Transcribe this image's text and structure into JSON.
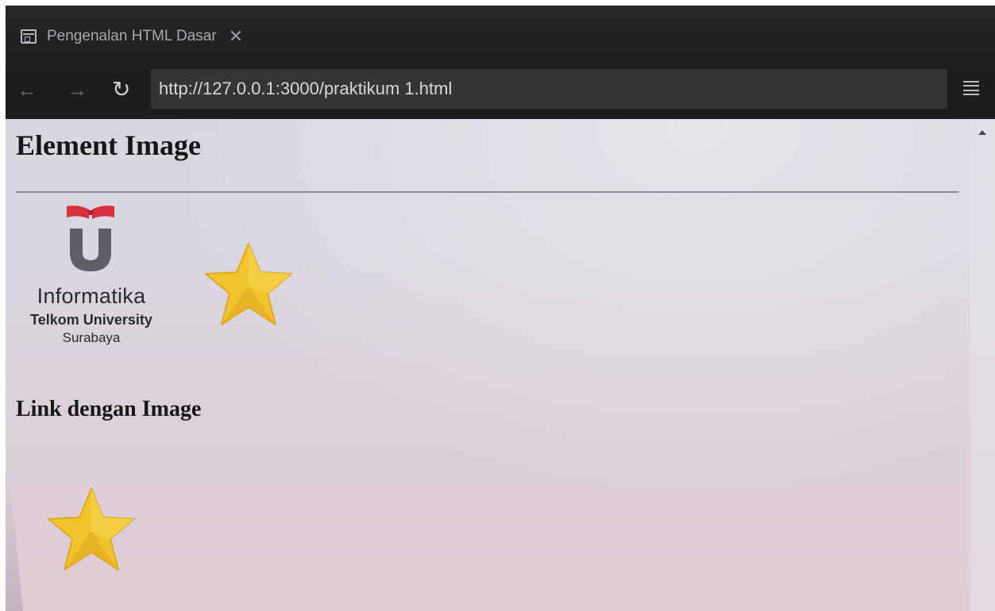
{
  "browser": {
    "tab": {
      "title": "Pengenalan HTML Dasar",
      "icon": "page-icon",
      "close_glyph": "✕"
    },
    "nav": {
      "back_glyph": "←",
      "forward_glyph": "→",
      "reload_glyph": "↻",
      "url": "http://127.0.0.1:3000/praktikum 1.html"
    }
  },
  "page": {
    "heading": "Element Image",
    "logo": {
      "title": "Informatika",
      "line1": "Telkom University",
      "line2": "Surabaya"
    },
    "subheading": "Link dengan Image"
  },
  "colors": {
    "star": "#f1c32c",
    "logo_red": "#d8303c",
    "logo_gray": "#5f6066"
  }
}
